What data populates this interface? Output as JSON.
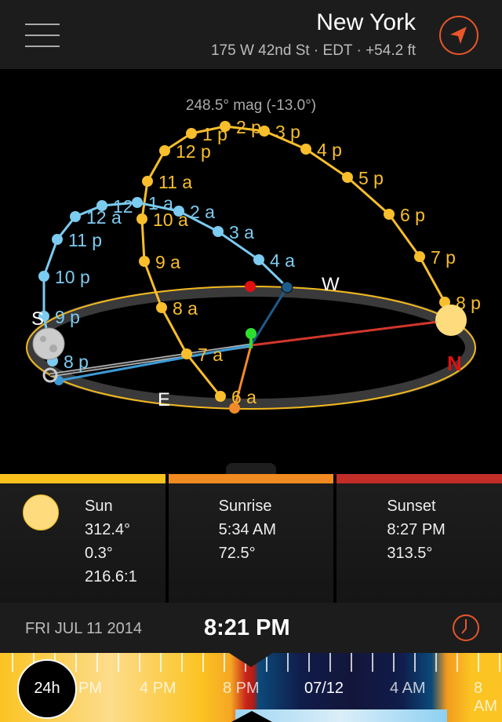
{
  "header": {
    "title": "New York",
    "subtitle": "175 W 42nd St · EDT · +54.2 ft",
    "menu_icon": "hamburger-icon",
    "location_icon": "location-arrow-icon"
  },
  "map": {
    "heading": "248.5° mag (-13.0°)",
    "compass": {
      "S": "S",
      "W": "W",
      "N": "N",
      "E": "E"
    },
    "sun_path": [
      "6 a",
      "7 a",
      "8 a",
      "9 a",
      "10 a",
      "11 a",
      "12 p",
      "1 p",
      "2 p",
      "3 p",
      "4 p",
      "5 p",
      "6 p",
      "7 p",
      "8 p"
    ],
    "moon_path": [
      "8 p",
      "9 p",
      "10 p",
      "11 p",
      "12 a",
      "12",
      "1 a",
      "2 a",
      "3 a",
      "4 a"
    ],
    "colors": {
      "sun": "#f8be2c",
      "moon": "#7ccbf0",
      "sunset_line": "#d2372a",
      "sunrise_line": "#f0892a",
      "moonset": "#1d5a8a"
    }
  },
  "info": [
    {
      "title": "Sun",
      "lines": [
        "312.4°",
        "0.3°",
        "216.6:1"
      ],
      "color": "#fbc21e"
    },
    {
      "title": "Sunrise",
      "lines": [
        "5:34 AM",
        "72.5°"
      ],
      "color": "#f28a22"
    },
    {
      "title": "Sunset",
      "lines": [
        "8:27 PM",
        "313.5°"
      ],
      "color": "#c22d27"
    }
  ],
  "datebar": {
    "date": "FRI JUL 11 2014",
    "time": "8:21 PM",
    "clock_icon": "clock-icon"
  },
  "timeline": {
    "mode": "24h",
    "labels": [
      "PM",
      "4 PM",
      "8 PM",
      "07/12",
      "4 AM",
      "8 AM"
    ]
  }
}
